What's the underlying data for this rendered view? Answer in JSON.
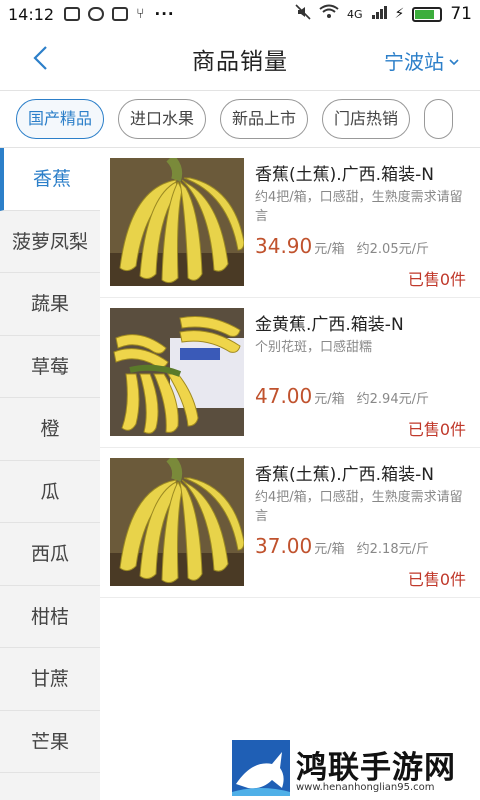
{
  "status_bar": {
    "time": "14:12",
    "dots": "···",
    "network": "4G",
    "battery_level": "71",
    "battery_fraction": 0.71
  },
  "header": {
    "title": "商品销量",
    "station": "宁波站"
  },
  "tabs": [
    {
      "label": "国产精品",
      "active": true
    },
    {
      "label": "进口水果",
      "active": false
    },
    {
      "label": "新品上市",
      "active": false
    },
    {
      "label": "门店热销",
      "active": false
    }
  ],
  "sidebar": [
    {
      "label": "香蕉",
      "active": true
    },
    {
      "label": "菠萝凤梨",
      "active": false
    },
    {
      "label": "蔬果",
      "active": false
    },
    {
      "label": "草莓",
      "active": false
    },
    {
      "label": "橙",
      "active": false
    },
    {
      "label": "瓜",
      "active": false
    },
    {
      "label": "西瓜",
      "active": false
    },
    {
      "label": "柑桔",
      "active": false
    },
    {
      "label": "甘蔗",
      "active": false
    },
    {
      "label": "芒果",
      "active": false
    }
  ],
  "products": [
    {
      "name": "香蕉(土蕉).广西.箱装-N",
      "desc": "约4把/箱，口感甜，生熟度需求请留言",
      "price": "34.90",
      "unit": "元/箱",
      "unit_price": "约2.05元/斤",
      "sold": "已售0件"
    },
    {
      "name": "金黄蕉.广西.箱装-N",
      "desc": "个别花斑，口感甜糯",
      "price": "47.00",
      "unit": "元/箱",
      "unit_price": "约2.94元/斤",
      "sold": "已售0件"
    },
    {
      "name": "香蕉(土蕉).广西.箱装-N",
      "desc": "约4把/箱，口感甜，生熟度需求请留言",
      "price": "37.00",
      "unit": "元/箱",
      "unit_price": "约2.18元/斤",
      "sold": "已售0件"
    }
  ],
  "watermark": {
    "title": "鸿联手游网",
    "url": "www.henanhonglian95.com"
  },
  "colors": {
    "accent": "#2c7fc9",
    "price": "#c0522d",
    "sold": "#c0392b"
  }
}
